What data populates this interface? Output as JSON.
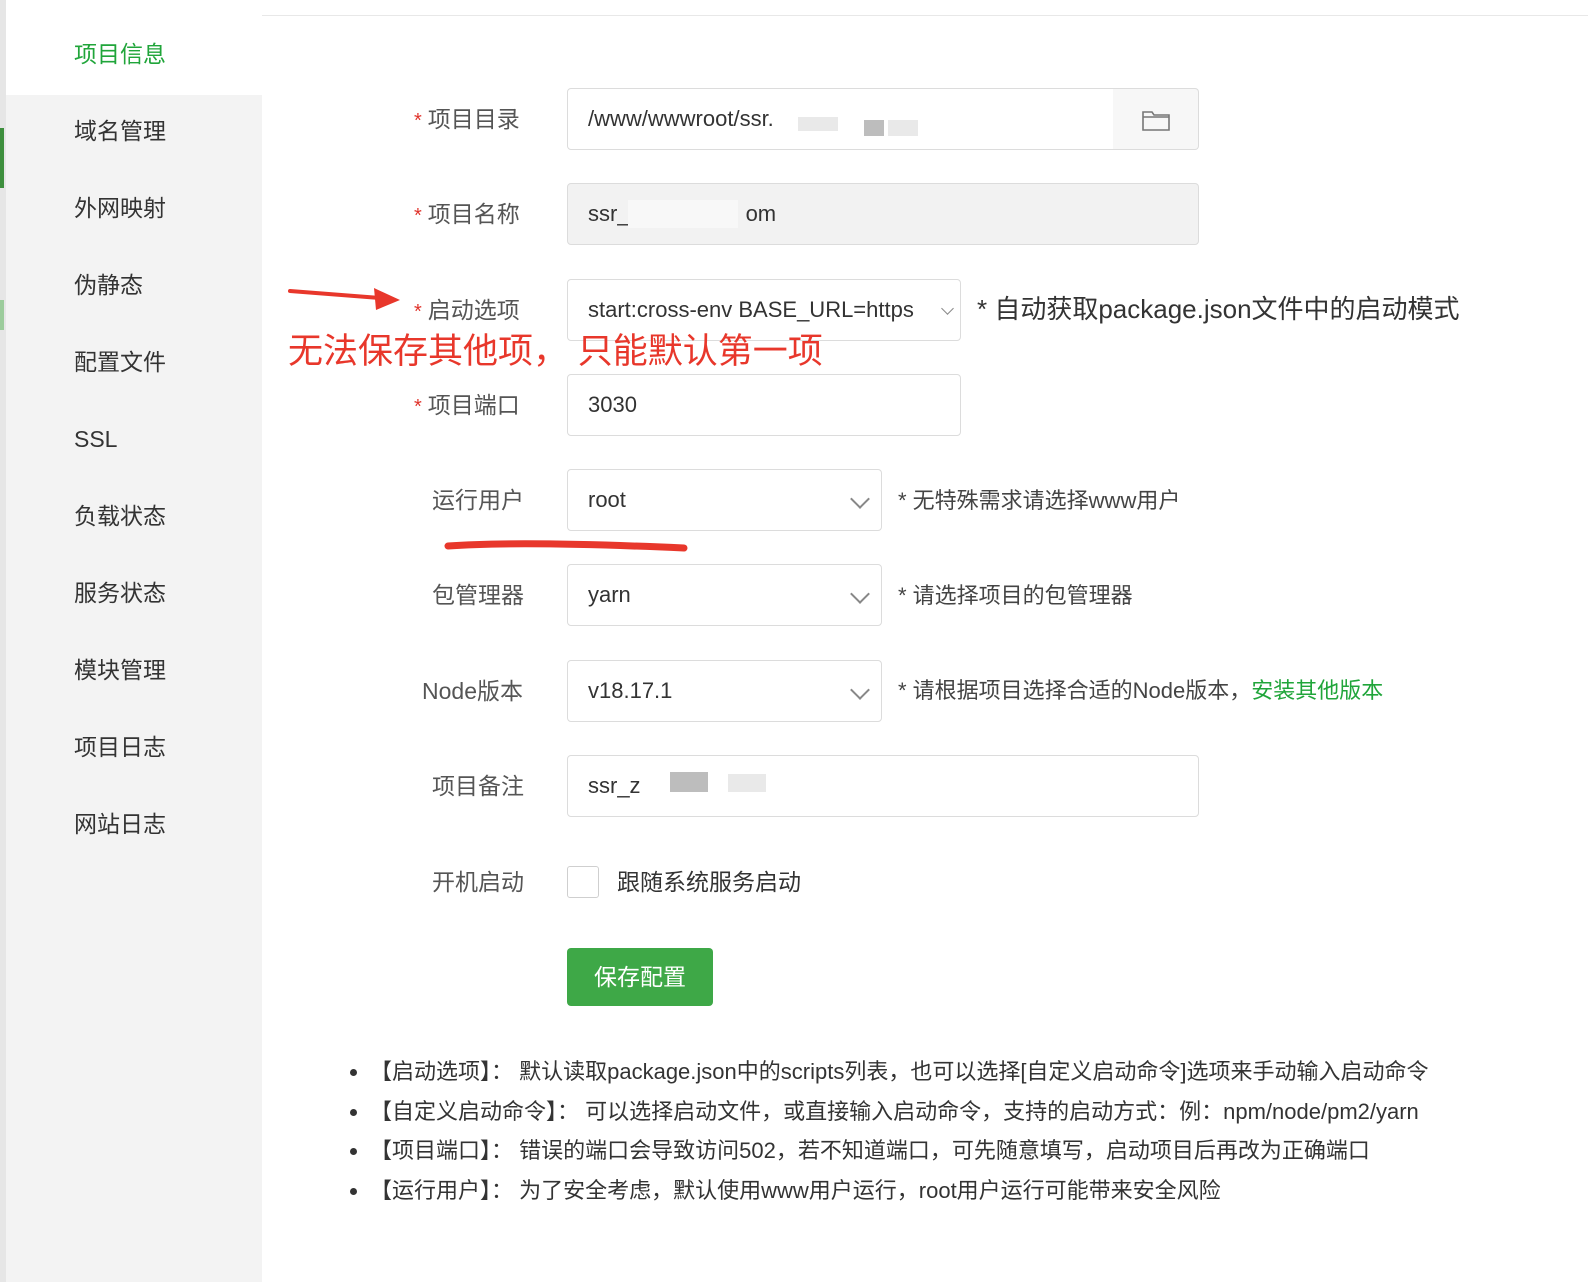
{
  "sidebar": {
    "items": [
      {
        "label": "项目信息",
        "active": true
      },
      {
        "label": "域名管理"
      },
      {
        "label": "外网映射"
      },
      {
        "label": "伪静态"
      },
      {
        "label": "配置文件"
      },
      {
        "label": "SSL"
      },
      {
        "label": "负载状态"
      },
      {
        "label": "服务状态"
      },
      {
        "label": "模块管理"
      },
      {
        "label": "项目日志"
      },
      {
        "label": "网站日志"
      }
    ]
  },
  "form": {
    "required_mark": "*",
    "project_dir": {
      "label": "项目目录",
      "value": "/www/wwwroot/ssr.",
      "browse_icon": "folder-icon"
    },
    "project_name": {
      "label": "项目名称",
      "value_prefix": "ssr_",
      "value_suffix": "om"
    },
    "start_option": {
      "label": "启动选项",
      "value": "start:cross-env BASE_URL=https",
      "hint": "* 自动获取package.json文件中的启动模式"
    },
    "project_port": {
      "label": "项目端口",
      "value": "3030"
    },
    "run_user": {
      "label": "运行用户",
      "value": "root",
      "hint": "* 无特殊需求请选择www用户"
    },
    "package_manager": {
      "label": "包管理器",
      "value": "yarn",
      "hint": "* 请选择项目的包管理器"
    },
    "node_version": {
      "label": "Node版本",
      "value": "v18.17.1",
      "hint": "* 请根据项目选择合适的Node版本，",
      "link": "安装其他版本"
    },
    "remark": {
      "label": "项目备注",
      "value": "ssr_z"
    },
    "autostart": {
      "label": "开机启动",
      "checkbox_label": "跟随系统服务启动",
      "checked": false
    },
    "save_label": "保存配置"
  },
  "annotation": {
    "text": "无法保存其他项，  只能默认第一项",
    "color": "#e8372b"
  },
  "notes": [
    "【启动选项】： 默认读取package.json中的scripts列表，也可以选择[自定义启动命令]选项来手动输入启动命令",
    "【自定义启动命令】： 可以选择启动文件，或直接输入启动命令，支持的启动方式：例：npm/node/pm2/yarn",
    "【项目端口】： 错误的端口会导致访问502，若不知道端口，可先随意填写，启动项目后再改为正确端口",
    "【运行用户】： 为了安全考虑，默认使用www用户运行，root用户运行可能带来安全风险"
  ],
  "colors": {
    "accent": "#20a53a",
    "button": "#3ea847",
    "required": "#e0332b"
  }
}
